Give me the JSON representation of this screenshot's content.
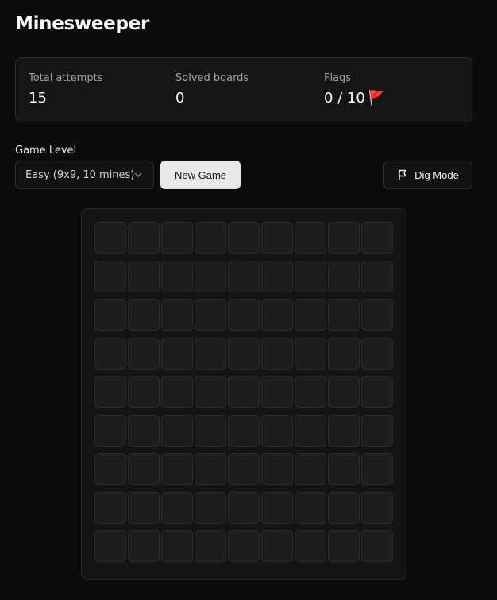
{
  "header": {
    "title": "Minesweeper"
  },
  "stats": {
    "attempts_label": "Total attempts",
    "attempts_value": "15",
    "solved_label": "Solved boards",
    "solved_value": "0",
    "flags_label": "Flags",
    "flags_value": "0 / 10",
    "flags_icon": "🚩"
  },
  "controls": {
    "level_label": "Game Level",
    "level_selected": "Easy (9x9, 10 mines)",
    "new_game_label": "New Game",
    "mode_label": "Dig Mode",
    "mode_icon": "flag-outline-icon"
  },
  "board": {
    "rows": 9,
    "cols": 9,
    "state": "all-unrevealed",
    "colors": {
      "cell": "#1d1d1d",
      "cell_border": "#2c2c2c",
      "board_bg": "#141414"
    }
  }
}
